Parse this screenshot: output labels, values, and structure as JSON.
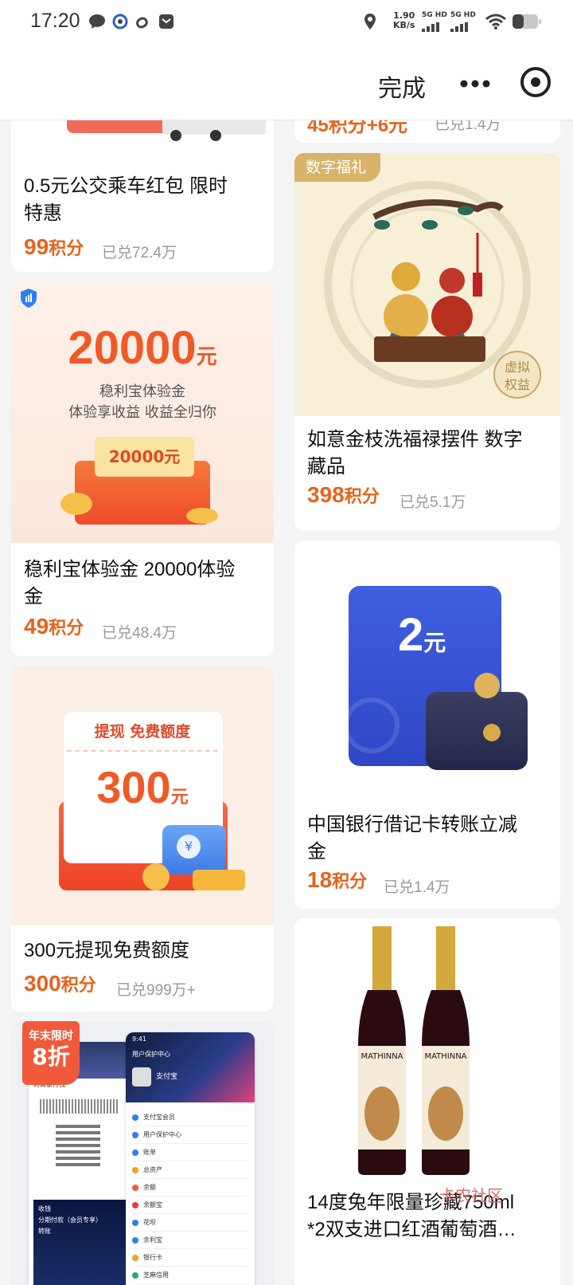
{
  "status_bar": {
    "time": "17:20",
    "net_speed_value": "1.90",
    "net_speed_unit": "KB/s",
    "signal1": "5G HD",
    "signal2": "5G HD"
  },
  "header": {
    "done_label": "完成"
  },
  "products": [
    {
      "title_line1": "0.5元公交乘车红包 限时",
      "title_line2": "特惠",
      "points": "99",
      "points_unit": "积分",
      "sold": "已兑72.4万"
    },
    {
      "title_line1": "稳利宝体验金 20000体验",
      "title_line2": "金",
      "points": "49",
      "points_unit": "积分",
      "sold": "已兑48.4万",
      "image_amount": "20000",
      "image_unit": "元",
      "image_line1": "稳利宝体验金",
      "image_line2": "体验享收益 收益全归你",
      "image_envelope_amount": "20000元"
    },
    {
      "title_line1": "300元提现免费额度",
      "title_line2": "",
      "points": "300",
      "points_unit": "积分",
      "sold": "已兑999万+",
      "image_header": "提现 免费额度",
      "image_amount": "300",
      "image_unit": "元",
      "image_coin_symbol": "¥"
    },
    {
      "promo_line1": "年末限时",
      "promo_line2": "8折",
      "screen_time": "9:41",
      "screen_header": "用户保护中心",
      "screen_brand": "支付宝",
      "screen_menu": [
        "支付宝会员",
        "用户保护中心",
        "账单",
        "总资产",
        "余额",
        "余额宝",
        "花呗",
        "余利宝",
        "银行卡",
        "芝麻信用"
      ],
      "screen_left_items": [
        "向商家付钱",
        "收钱",
        "分期付款（会员专享）",
        "转账"
      ]
    },
    {
      "partial_title": "45积分+6元",
      "partial_sold": "已兑1.4万"
    },
    {
      "badge": "数字福礼",
      "title_line1": "如意金枝洗福禄摆件 数字",
      "title_line2": "藏品",
      "points": "398",
      "points_unit": "积分",
      "sold": "已兑5.1万",
      "virtual_seal_line1": "虚拟",
      "virtual_seal_line2": "权益"
    },
    {
      "title_line1": "中国银行借记卡转账立减",
      "title_line2": "金",
      "points": "18",
      "points_unit": "积分",
      "sold": "已兑1.4万",
      "image_amount": "2",
      "image_unit": "元"
    },
    {
      "title_line1": "14度兔年限量珍藏750ml",
      "title_line2": "*2双支进口红酒葡萄酒…",
      "wine_label": "MATHINNA"
    }
  ],
  "watermark": "卡农社区",
  "colors": {
    "accent": "#e8631c",
    "blue_card": "#3b57d9",
    "gold_badge": "#d9b36a"
  },
  "icons": [
    "chat-icon",
    "app-icon",
    "link-icon",
    "mail-icon",
    "location-icon",
    "signal-icon",
    "wifi-icon",
    "battery-icon",
    "more-icon",
    "target-icon",
    "shield-icon"
  ]
}
